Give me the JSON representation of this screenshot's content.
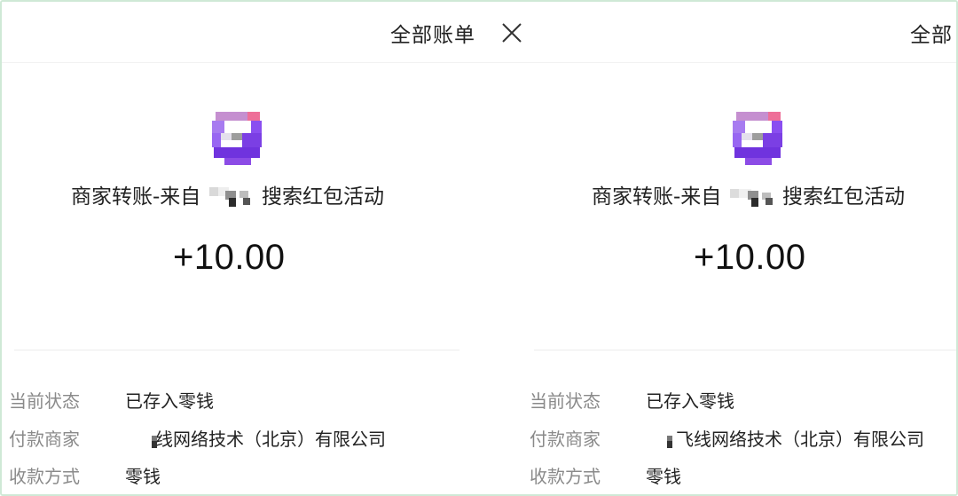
{
  "header": {
    "title": "全部账单",
    "right_title": "全部"
  },
  "icons": {
    "close": "close-icon",
    "app_logo": "app-logo-icon"
  },
  "colors": {
    "logo_primary": "#7b3fe4",
    "logo_accent": "#e7497f",
    "label_gray": "#8a8a8a"
  },
  "transaction": {
    "description_prefix": "商家转账-来自",
    "description_suffix": "搜索红包活动",
    "amount": "+10.00"
  },
  "details": [
    {
      "label": "当前状态",
      "value": "已存入零钱"
    },
    {
      "label": "付款商家",
      "value": "线网络技术（北京）有限公司"
    },
    {
      "label": "收款方式",
      "value": "零钱"
    }
  ],
  "right_panel": {
    "description_prefix": "商家转账-来自",
    "description_suffix": "搜索红包活动",
    "amount": "+10.00",
    "details": [
      {
        "label": "当前状态",
        "value": "已存入零钱"
      },
      {
        "label": "付款商家",
        "value": "飞线网络技术（北京）有限公司"
      },
      {
        "label": "收款方式",
        "value": "零钱"
      }
    ]
  }
}
